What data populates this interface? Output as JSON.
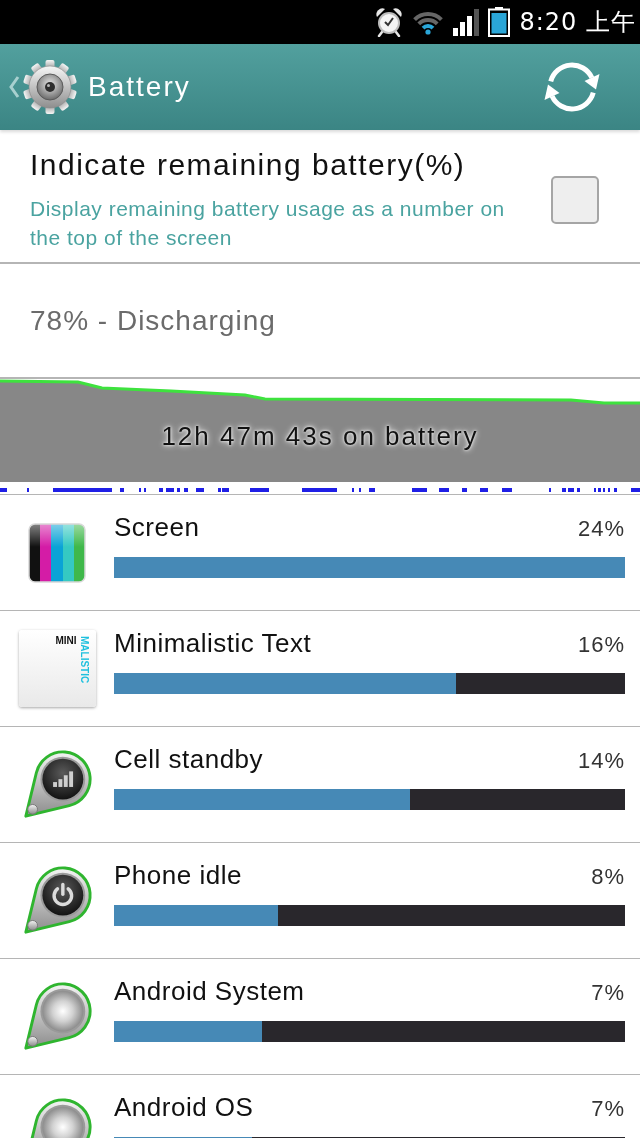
{
  "status_bar": {
    "time": "8:20 上午"
  },
  "action_bar": {
    "title": "Battery"
  },
  "setting": {
    "title": "Indicate remaining battery(%)",
    "summary": "Display remaining battery usage as a number on the top of the screen",
    "checked": false
  },
  "battery_status": {
    "text": "78% - Discharging"
  },
  "history": {
    "duration": "12h 47m 43s on battery"
  },
  "usage": [
    {
      "kind": "screen",
      "name": "Screen",
      "percent": "24%",
      "level": 1
    },
    {
      "kind": "app",
      "name": "Minimalistic Text",
      "percent": "16%",
      "level": 0.67,
      "logo_text": "MINI",
      "logo_text_vertical": "MALISTIC"
    },
    {
      "kind": "cell",
      "name": "Cell standby",
      "percent": "14%",
      "level": 0.58
    },
    {
      "kind": "idle",
      "name": "Phone idle",
      "percent": "8%",
      "level": 0.32
    },
    {
      "kind": "system",
      "name": "Android System",
      "percent": "7%",
      "level": 0.29
    },
    {
      "kind": "system",
      "name": "Android OS",
      "percent": "7%",
      "level": 0.27
    }
  ]
}
